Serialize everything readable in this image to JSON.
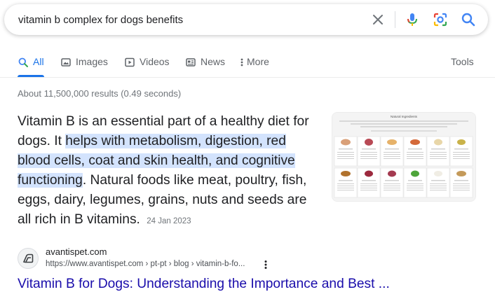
{
  "search": {
    "query": "vitamin b complex for dogs benefits",
    "icons": [
      "close-icon",
      "microphone-icon",
      "google-lens-icon",
      "search-icon"
    ]
  },
  "tabs": [
    {
      "label": "All",
      "icon": "search-icon",
      "active": true
    },
    {
      "label": "Images",
      "icon": "image-icon"
    },
    {
      "label": "Videos",
      "icon": "play-icon"
    },
    {
      "label": "News",
      "icon": "news-icon"
    },
    {
      "label": "More",
      "icon": "more-vertical-icon"
    }
  ],
  "tools_label": "Tools",
  "stats": "About 11,500,000 results (0.49 seconds)",
  "featured": {
    "text_before": "Vitamin B is an essential part of a healthy diet for dogs. It ",
    "text_highlight": "helps with metabolism, digestion, red blood cells, coat and skin health, and cognitive functioning",
    "text_after": ". Natural foods like meat, poultry, fish, eggs, dairy, legumes, grains, nuts and seeds are all rich in B vitamins.",
    "date": "24 Jan 2023",
    "thumbnail_title": "Natural Ingredients"
  },
  "result": {
    "site_name": "avantispet.com",
    "url": "https://www.avantispet.com › pt-pt › blog › vitamin-b-fo...",
    "title": "Vitamin B for Dogs: Understanding the Importance and Best ..."
  },
  "colors": {
    "link": "#1a0dab",
    "accent": "#1a73e8",
    "highlight": "#d3e3fd"
  }
}
